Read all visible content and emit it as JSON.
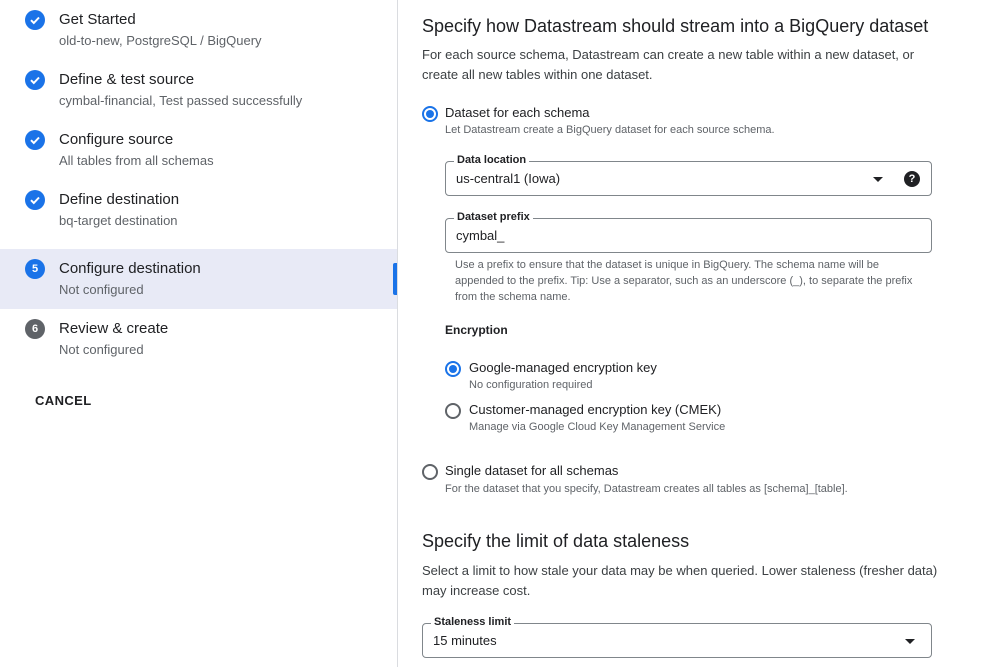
{
  "sidebar": {
    "steps": [
      {
        "title": "Get Started",
        "subtitle": "old-to-new, PostgreSQL / BigQuery",
        "state": "done"
      },
      {
        "title": "Define & test source",
        "subtitle": "cymbal-financial, Test passed successfully",
        "state": "done"
      },
      {
        "title": "Configure source",
        "subtitle": "All tables from all schemas",
        "state": "done"
      },
      {
        "title": "Define destination",
        "subtitle": "bq-target destination",
        "state": "done"
      },
      {
        "number": "5",
        "title": "Configure destination",
        "subtitle": "Not configured",
        "state": "current"
      },
      {
        "number": "6",
        "title": "Review & create",
        "subtitle": "Not configured",
        "state": "pending"
      }
    ],
    "cancel_label": "CANCEL"
  },
  "main": {
    "heading": "Specify how Datastream should stream into a BigQuery dataset",
    "description": "For each source schema, Datastream can create a new table within a new dataset, or create all new tables within one dataset.",
    "option_each": {
      "label": "Dataset for each schema",
      "sub": "Let Datastream create a BigQuery dataset for each source schema.",
      "selected": true
    },
    "data_location": {
      "label": "Data location",
      "value": "us-central1 (Iowa)"
    },
    "dataset_prefix": {
      "label": "Dataset prefix",
      "value": "cymbal_",
      "hint": "Use a prefix to ensure that the dataset is unique in BigQuery. The schema name will be appended to the prefix. Tip: Use a separator, such as an underscore (_), to separate the prefix from the schema name."
    },
    "encryption": {
      "heading": "Encryption",
      "google": {
        "label": "Google-managed encryption key",
        "sub": "No configuration required",
        "selected": true
      },
      "cmek": {
        "label": "Customer-managed encryption key (CMEK)",
        "sub": "Manage via Google Cloud Key Management Service",
        "selected": false
      }
    },
    "option_single": {
      "label": "Single dataset for all schemas",
      "sub": "For the dataset that you specify, Datastream creates all tables as [schema]_[table].",
      "selected": false
    },
    "staleness": {
      "heading": "Specify the limit of data staleness",
      "description": "Select a limit to how stale your data may be when queried. Lower staleness (fresher data) may increase cost.",
      "label": "Staleness limit",
      "value": "15 minutes"
    }
  },
  "colors": {
    "accent": "#1a73e8",
    "active_bg": "#e8eaf6",
    "pending": "#5f6368"
  }
}
